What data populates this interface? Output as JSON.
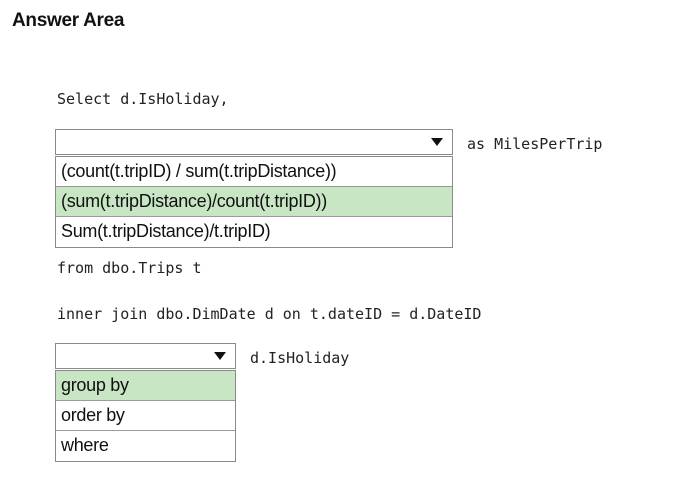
{
  "header": {
    "title": "Answer Area"
  },
  "code": {
    "line1": "Select d.IsHoliday,",
    "alias": "as MilesPerTrip",
    "from_line": "from dbo.Trips t",
    "join_line": "inner join dbo.DimDate d on t.dateID = d.DateID",
    "group_col": "d.IsHoliday"
  },
  "dropdown1": {
    "selected_value": "",
    "options": [
      {
        "label": "(count(t.tripID) / sum(t.tripDistance))",
        "selected": false
      },
      {
        "label": "(sum(t.tripDistance)/count(t.tripID))",
        "selected": true
      },
      {
        "label": "Sum(t.tripDistance)/t.tripID)",
        "selected": false
      }
    ]
  },
  "dropdown2": {
    "selected_value": "",
    "options": [
      {
        "label": "group by",
        "selected": true
      },
      {
        "label": "order by",
        "selected": false
      },
      {
        "label": "where",
        "selected": false
      }
    ]
  },
  "colors": {
    "selected_highlight": "#c8e6c4",
    "border": "#8a8a8a"
  },
  "icons": {
    "dropdown_arrow": "triangle-down-icon"
  }
}
